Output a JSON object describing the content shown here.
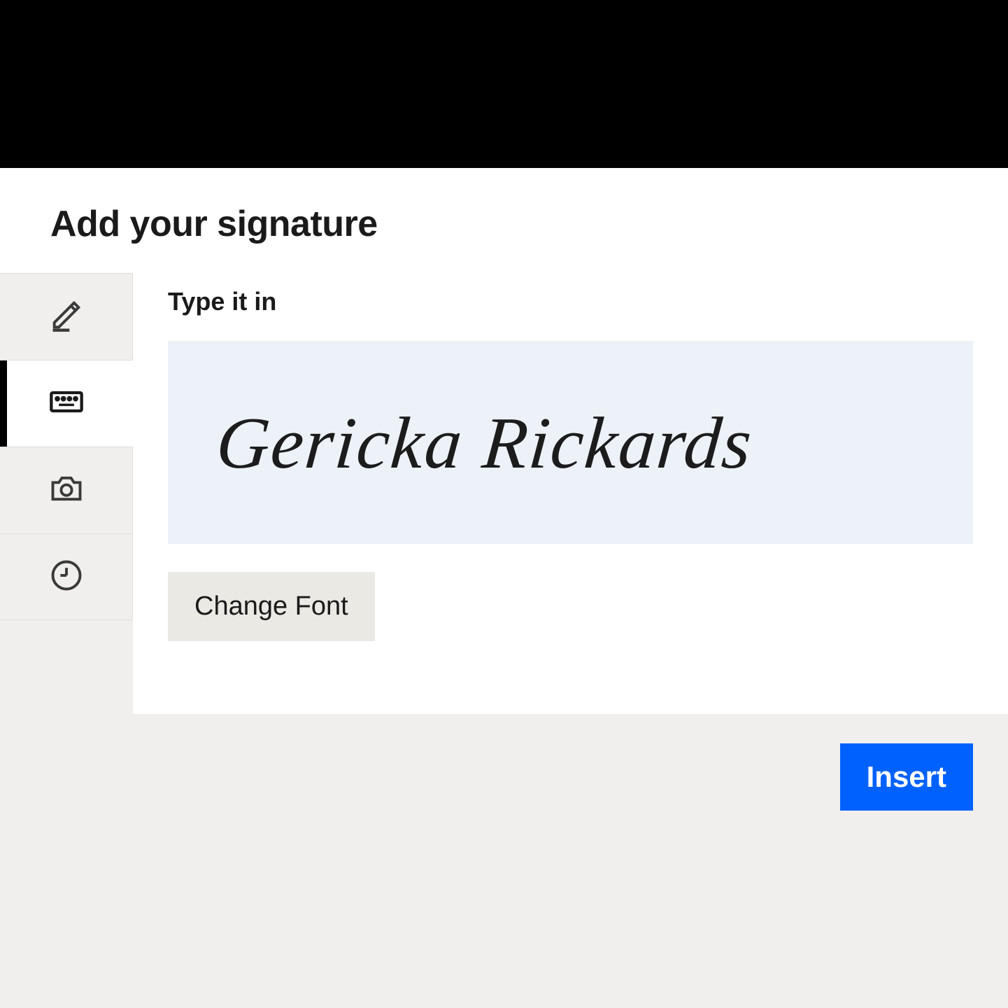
{
  "modal": {
    "title": "Add your signature"
  },
  "sidebar": {
    "tabs": {
      "draw": "draw",
      "type": "type",
      "camera": "camera",
      "recent": "recent"
    }
  },
  "panel": {
    "label": "Type it in",
    "signature_value": "Gericka Rickards",
    "change_font_label": "Change Font"
  },
  "footer": {
    "insert_label": "Insert"
  }
}
